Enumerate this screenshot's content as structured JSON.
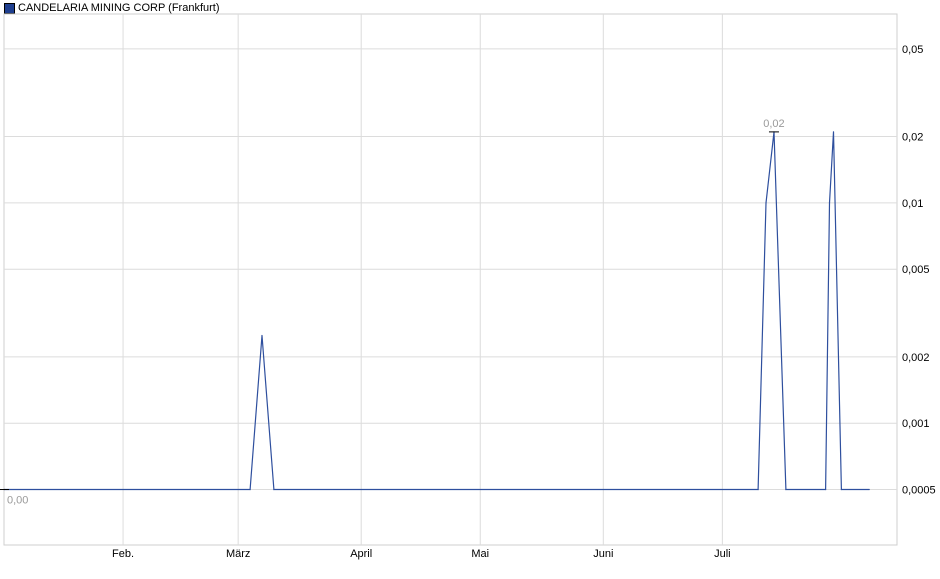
{
  "legend": {
    "label": "CANDELARIA MINING CORP (Frankfurt)",
    "color": "#1f3f8f"
  },
  "chart_data": {
    "type": "line",
    "title": "",
    "series": [
      {
        "name": "CANDELARIA MINING CORP (Frankfurt)",
        "color": "#2e4f9e",
        "points": [
          {
            "x": "2024-01-02",
            "y": 0.0005
          },
          {
            "x": "2024-03-04",
            "y": 0.0005
          },
          {
            "x": "2024-03-07",
            "y": 0.0025
          },
          {
            "x": "2024-03-10",
            "y": 0.0005
          },
          {
            "x": "2024-07-10",
            "y": 0.0005
          },
          {
            "x": "2024-07-12",
            "y": 0.01
          },
          {
            "x": "2024-07-14",
            "y": 0.021
          },
          {
            "x": "2024-07-17",
            "y": 0.0005
          },
          {
            "x": "2024-07-27",
            "y": 0.0005
          },
          {
            "x": "2024-07-28",
            "y": 0.01
          },
          {
            "x": "2024-07-29",
            "y": 0.021
          },
          {
            "x": "2024-07-31",
            "y": 0.0005
          },
          {
            "x": "2024-08-07",
            "y": 0.0005
          }
        ]
      }
    ],
    "y_scale": "log",
    "y_ticks": [
      {
        "value": 0.0005,
        "label": "0,0005"
      },
      {
        "value": 0.001,
        "label": "0,001"
      },
      {
        "value": 0.002,
        "label": "0,002"
      },
      {
        "value": 0.005,
        "label": "0,005"
      },
      {
        "value": 0.01,
        "label": "0,01"
      },
      {
        "value": 0.02,
        "label": "0,02"
      },
      {
        "value": 0.05,
        "label": "0,05"
      }
    ],
    "x_ticks": [
      {
        "date": "2024-02-01",
        "label": "Feb."
      },
      {
        "date": "2024-03-01",
        "label": "März"
      },
      {
        "date": "2024-04-01",
        "label": "April"
      },
      {
        "date": "2024-05-01",
        "label": "Mai"
      },
      {
        "date": "2024-06-01",
        "label": "Juni"
      },
      {
        "date": "2024-07-01",
        "label": "Juli"
      }
    ],
    "annotations": [
      {
        "x": "2024-07-14",
        "y": 0.021,
        "label": "0,02",
        "kind": "max"
      },
      {
        "x": "2024-01-02",
        "y": 0.0005,
        "label": "0,00",
        "kind": "min"
      }
    ],
    "x_range": [
      "2024-01-02",
      "2024-08-14"
    ],
    "y_range": [
      0.00028,
      0.072
    ],
    "grid": true,
    "legend_position": "top-left"
  }
}
